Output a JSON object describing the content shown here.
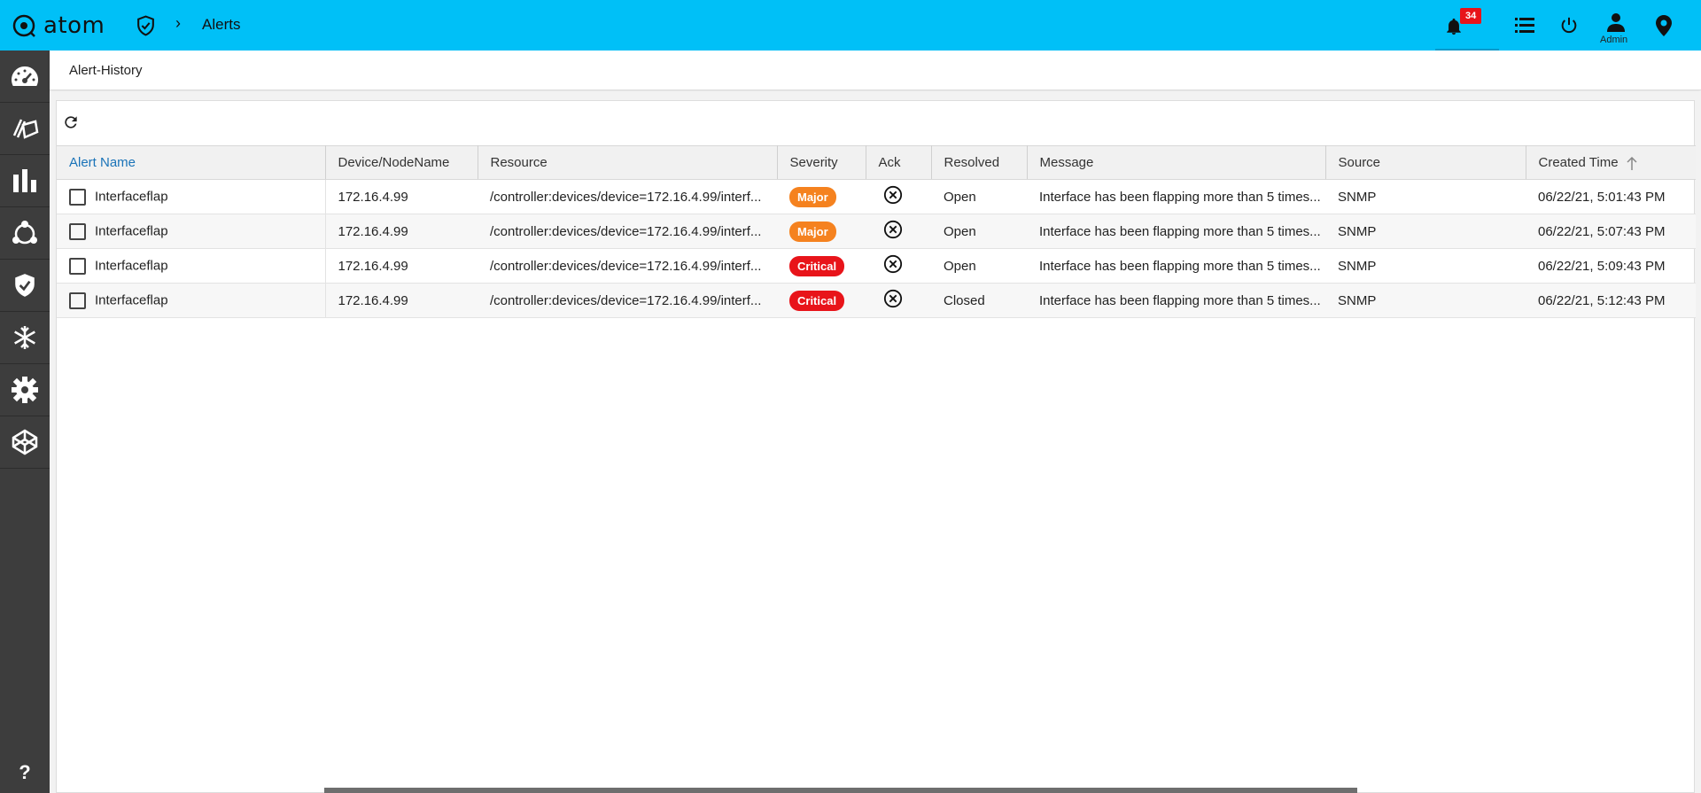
{
  "topbar": {
    "logo_text": "atom",
    "breadcrumb_title": "Alerts",
    "notification_count": "34",
    "admin_label": "Admin",
    "icons": [
      "bell-icon",
      "list-icon",
      "power-icon",
      "user-icon",
      "location-icon"
    ]
  },
  "sidebar": {
    "items": [
      "dashboard-icon",
      "devices-icon",
      "analytics-icon",
      "topology-icon",
      "security-shield-icon",
      "snowflake-icon",
      "settings-gear-icon",
      "codepen-cube-icon"
    ],
    "help_label": "?"
  },
  "page": {
    "title": "Alert-History"
  },
  "table": {
    "columns": {
      "alert_name": "Alert Name",
      "device": "Device/NodeName",
      "resource": "Resource",
      "severity": "Severity",
      "ack": "Ack",
      "resolved": "Resolved",
      "message": "Message",
      "source": "Source",
      "created": "Created Time"
    },
    "rows": [
      {
        "alert_name": "Interfaceflap",
        "device": "172.16.4.99",
        "resource": "/controller:devices/device=172.16.4.99/interf...",
        "severity": "Major",
        "resolved": "Open",
        "message": "Interface has been flapping more than 5 times...",
        "source": "SNMP",
        "created": "06/22/21, 5:01:43 PM"
      },
      {
        "alert_name": "Interfaceflap",
        "device": "172.16.4.99",
        "resource": "/controller:devices/device=172.16.4.99/interf...",
        "severity": "Major",
        "resolved": "Open",
        "message": "Interface has been flapping more than 5 times...",
        "source": "SNMP",
        "created": "06/22/21, 5:07:43 PM"
      },
      {
        "alert_name": "Interfaceflap",
        "device": "172.16.4.99",
        "resource": "/controller:devices/device=172.16.4.99/interf...",
        "severity": "Critical",
        "resolved": "Open",
        "message": "Interface has been flapping more than 5 times...",
        "source": "SNMP",
        "created": "06/22/21, 5:09:43 PM"
      },
      {
        "alert_name": "Interfaceflap",
        "device": "172.16.4.99",
        "resource": "/controller:devices/device=172.16.4.99/interf...",
        "severity": "Critical",
        "resolved": "Closed",
        "message": "Interface has been flapping more than 5 times...",
        "source": "SNMP",
        "created": "06/22/21, 5:12:43 PM"
      }
    ]
  },
  "colors": {
    "topbar": "#00c0f7",
    "sidebar": "#3d3d3d",
    "major": "#f5821f",
    "critical": "#e8141a",
    "link": "#1a73b8"
  }
}
